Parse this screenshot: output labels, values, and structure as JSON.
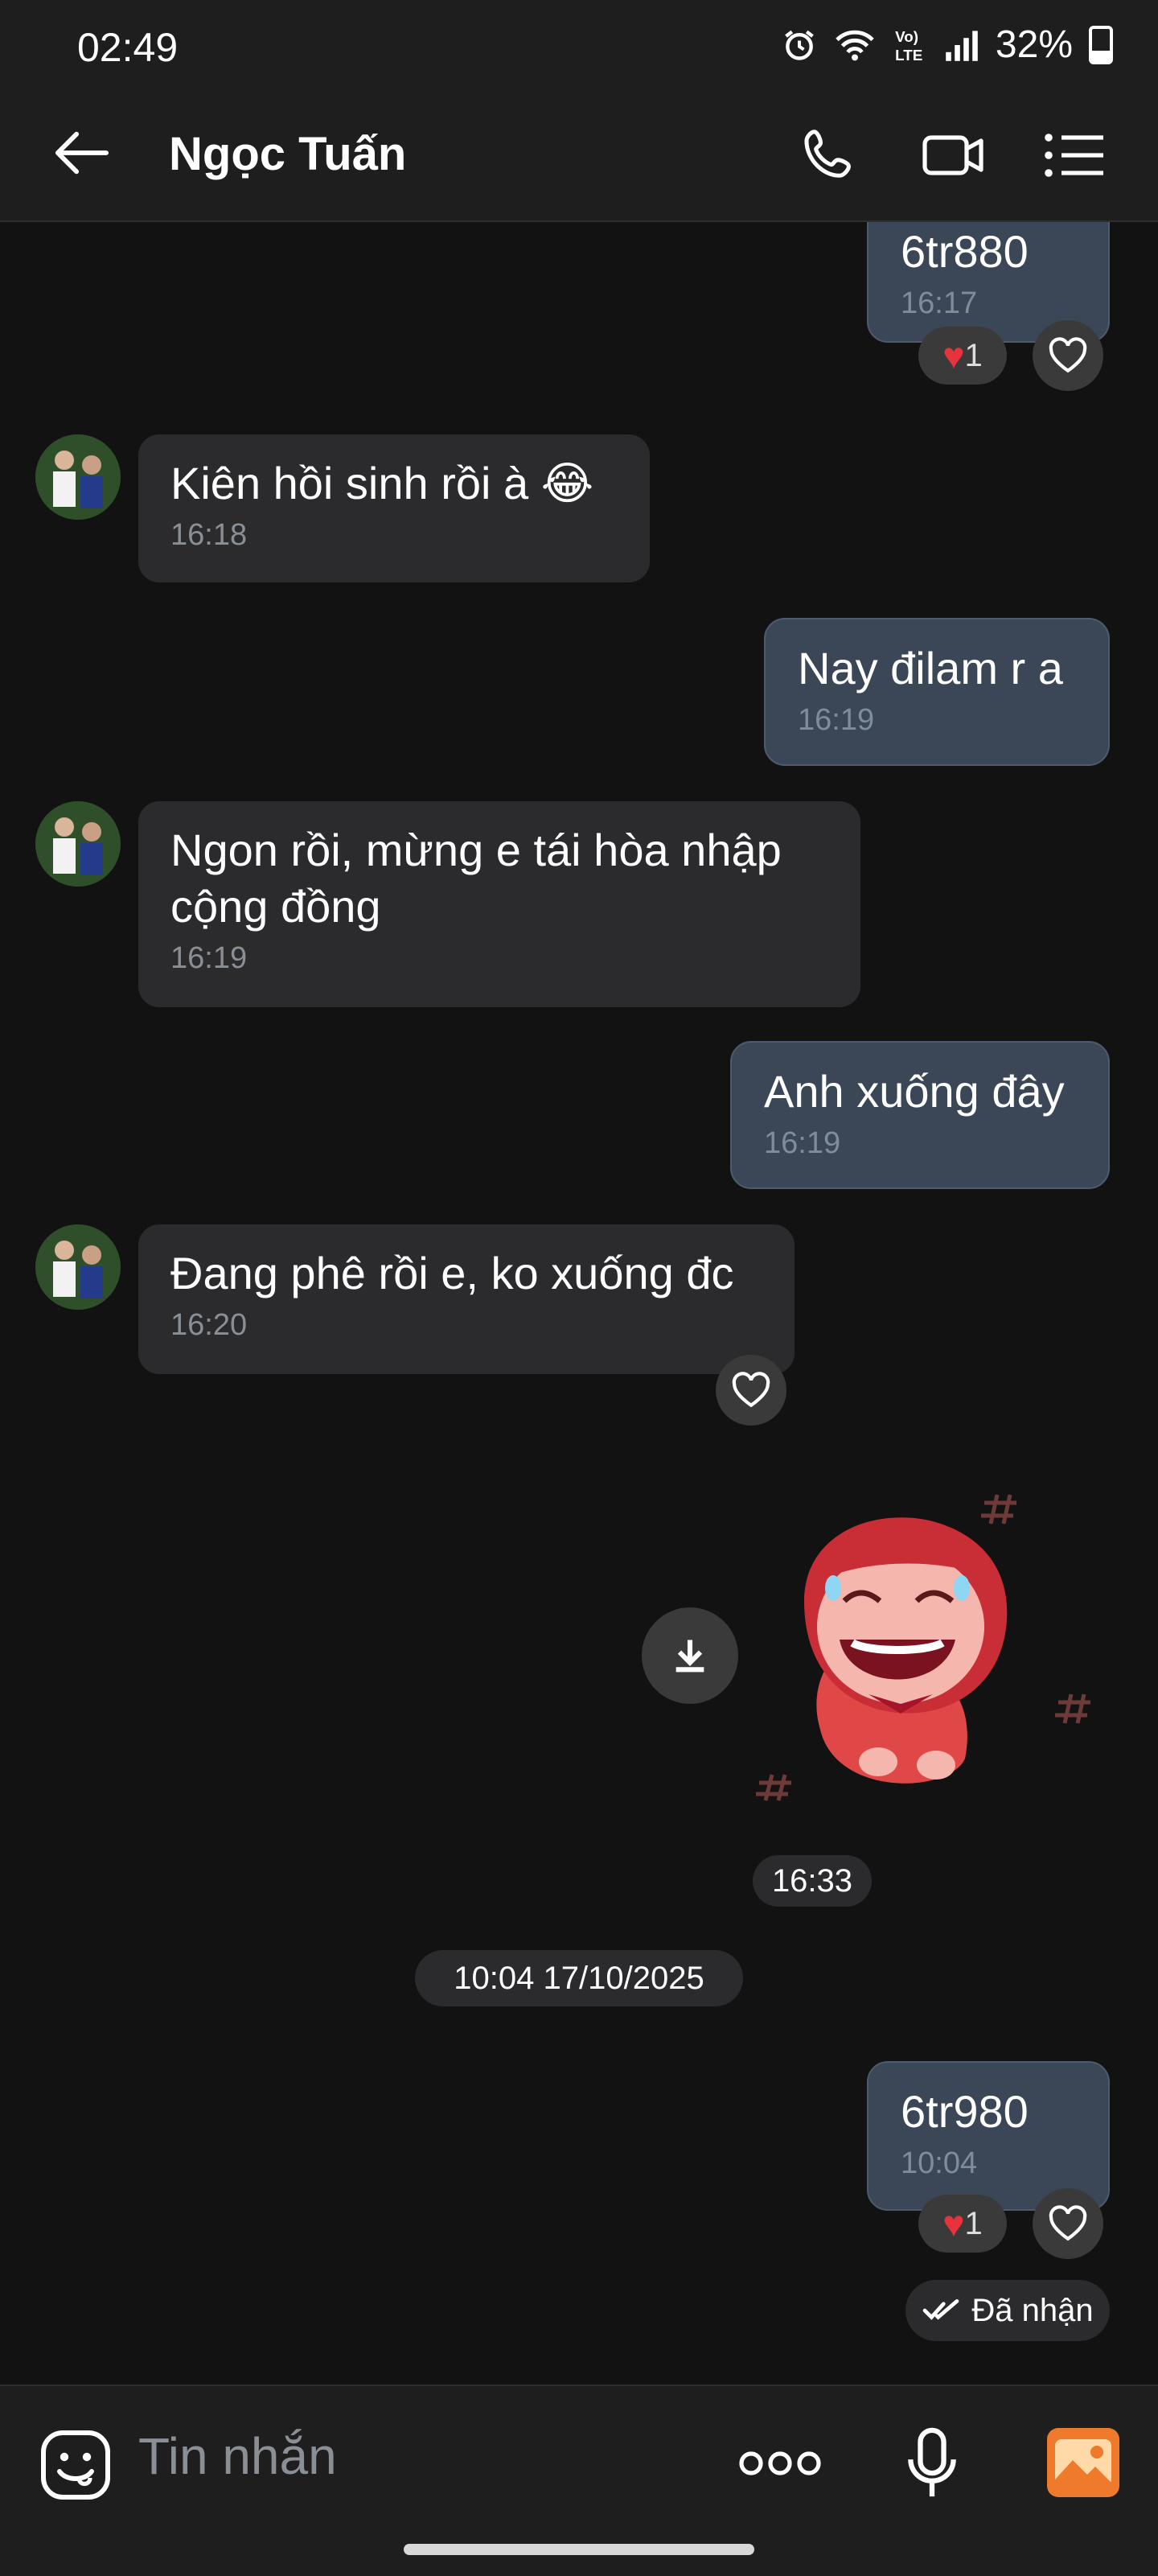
{
  "status_bar": {
    "time": "02:49",
    "battery": "32%"
  },
  "header": {
    "contact_name": "Ngọc Tuấn"
  },
  "messages": [
    {
      "direction": "out",
      "text": "6tr880",
      "time": "16:17",
      "reaction_count": "1"
    },
    {
      "direction": "in",
      "text": "Kiên hồi sinh rồi à 😂",
      "time": "16:18"
    },
    {
      "direction": "out",
      "text": "Nay đilam r a",
      "time": "16:19"
    },
    {
      "direction": "in",
      "text": "Ngon rồi, mừng e tái hòa nhập cộng đồng",
      "time": "16:19"
    },
    {
      "direction": "out",
      "text": "Anh xuống đây",
      "time": "16:19"
    },
    {
      "direction": "in",
      "text": "Đang phê rồi e, ko xuống đc",
      "time": "16:20"
    },
    {
      "direction": "out",
      "type": "sticker",
      "time": "16:33"
    },
    {
      "direction": "out",
      "text": "6tr980",
      "time": "10:04",
      "reaction_count": "1"
    }
  ],
  "date_separator": "10:04 17/10/2025",
  "delivery_status": "Đã nhận",
  "input": {
    "placeholder": "Tin nhắn"
  },
  "colors": {
    "background": "#121212",
    "incoming_bubble": "#2b2b2d",
    "outgoing_bubble": "#3b4756",
    "gallery_accent": "#f07a2b"
  },
  "icons": [
    "back-arrow-icon",
    "phone-icon",
    "video-call-icon",
    "menu-list-icon",
    "heart-icon",
    "download-icon",
    "double-check-icon",
    "sticker-emoji-icon",
    "more-dots-icon",
    "microphone-icon",
    "gallery-icon"
  ]
}
